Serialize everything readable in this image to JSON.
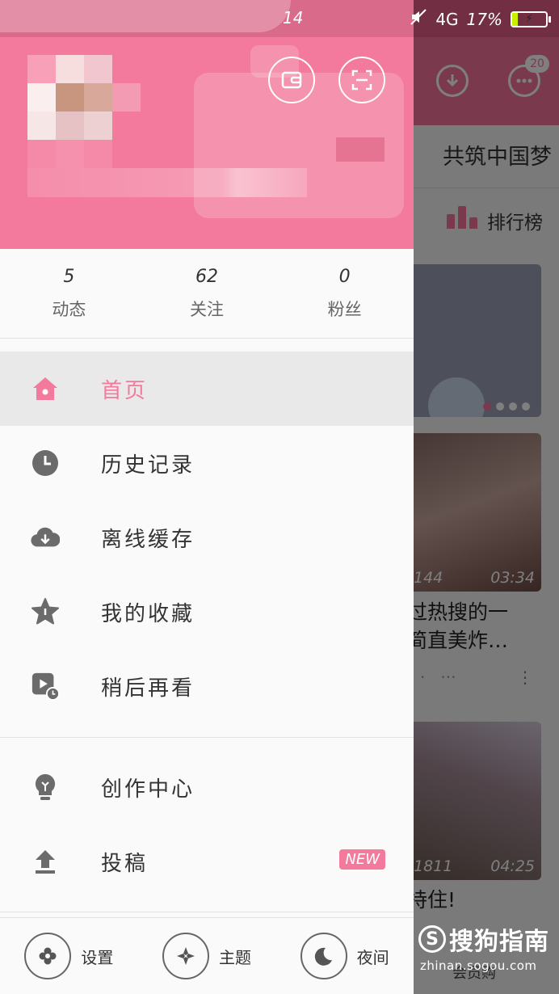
{
  "status_bar": {
    "time_partial": "14",
    "network": "4G",
    "battery": "17%",
    "battery_level": 0.17
  },
  "drawer": {
    "header": {
      "wallet_icon": "wallet-icon",
      "scan_icon": "scan-icon"
    },
    "stats": [
      {
        "value": "5",
        "label": "动态"
      },
      {
        "value": "62",
        "label": "关注"
      },
      {
        "value": "0",
        "label": "粉丝"
      }
    ],
    "menu_primary": [
      {
        "label": "首页",
        "icon": "home-icon",
        "active": true
      },
      {
        "label": "历史记录",
        "icon": "history-clock-icon"
      },
      {
        "label": "离线缓存",
        "icon": "cloud-download-icon"
      },
      {
        "label": "我的收藏",
        "icon": "star-icon"
      },
      {
        "label": "稍后再看",
        "icon": "watch-later-icon"
      }
    ],
    "menu_secondary": [
      {
        "label": "创作中心",
        "icon": "lightbulb-icon"
      },
      {
        "label": "投稿",
        "icon": "upload-icon",
        "badge": "NEW"
      }
    ],
    "bottom_bar": [
      {
        "label": "设置",
        "icon": "settings-icon"
      },
      {
        "label": "主题",
        "icon": "theme-icon"
      },
      {
        "label": "夜间",
        "icon": "night-mode-icon"
      }
    ]
  },
  "background_app": {
    "message_badge": "20",
    "slogan": "共筑中国梦",
    "rank_label": "排行榜",
    "card1": {
      "views": "144",
      "duration": "03:34",
      "title_line1": "过热搜的一",
      "title_line2": "简直美炸…"
    },
    "card2": {
      "views": "1811",
      "duration": "04:25",
      "title": "持住!"
    },
    "bottom_tab": "会员购"
  },
  "watermark": {
    "brand": "搜狗指南",
    "url": "zhinan.sogou.com"
  },
  "colors": {
    "accent": "#f37a9c",
    "header_bg": "#f37a9c",
    "drawer_bg": "#fafafa",
    "active_item_bg": "#e9e9e9"
  }
}
